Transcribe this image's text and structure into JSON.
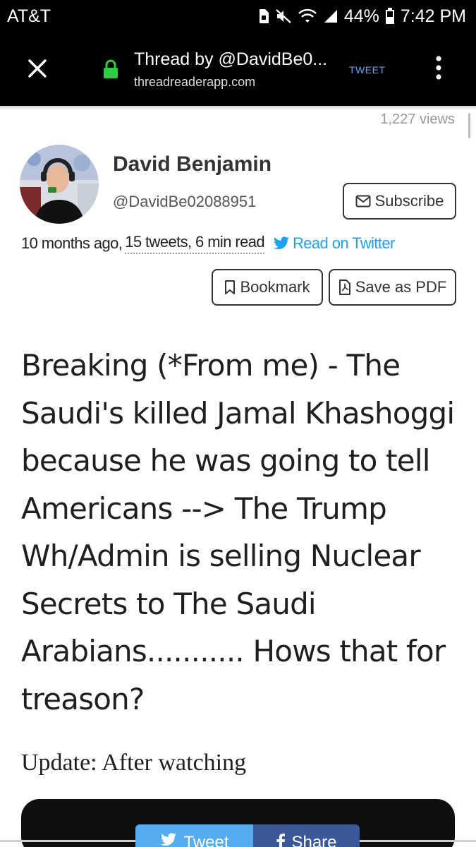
{
  "status_bar": {
    "carrier": "AT&T",
    "battery": "44%",
    "time": "7:42 PM"
  },
  "browser": {
    "title": "Thread by @DavidBe0...",
    "host": "threadreaderapp.com",
    "tweet_action": "TWEET"
  },
  "thread": {
    "views": "1,227 views",
    "author_name": "David Benjamin",
    "author_handle": "@DavidBe02088951",
    "subscribe_label": "Subscribe",
    "meta_time": "10 months ago,",
    "meta_stats": "15 tweets, 6 min read",
    "read_on_twitter": "Read on Twitter",
    "bookmark_label": "Bookmark",
    "save_pdf_label": "Save as PDF",
    "first_tweet": "Breaking (*From me) - The Saudi's killed Jamal Khashoggi because he was going to tell Americans --> The Trump Wh/Admin is selling Nuclear Secrets to The Saudi Arabians........... Hows that for treason?",
    "second_tweet": "Update: After watching"
  },
  "share_bar": {
    "tweet_label": "Tweet",
    "share_label": "Share"
  },
  "colors": {
    "twitter_blue": "#1da1f2",
    "tweet_button": "#55acee",
    "facebook_blue": "#3b5998",
    "lock_green": "#2ecc40"
  }
}
